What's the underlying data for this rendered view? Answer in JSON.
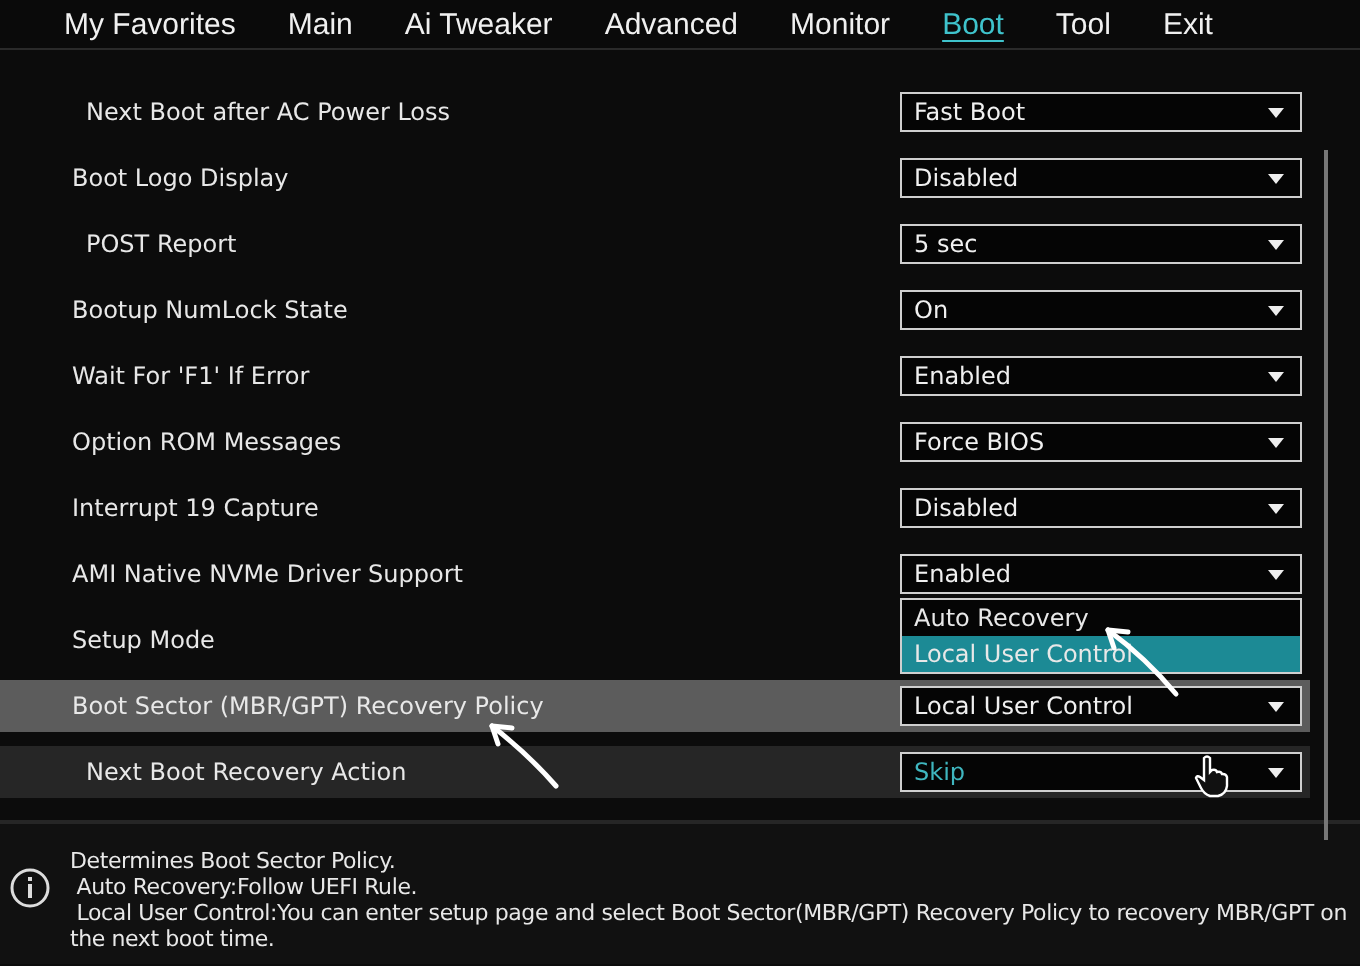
{
  "tabs": [
    {
      "label": "My Favorites",
      "selected": false
    },
    {
      "label": "Main",
      "selected": false
    },
    {
      "label": "Ai Tweaker",
      "selected": false
    },
    {
      "label": "Advanced",
      "selected": false
    },
    {
      "label": "Monitor",
      "selected": false
    },
    {
      "label": "Boot",
      "selected": true
    },
    {
      "label": "Tool",
      "selected": false
    },
    {
      "label": "Exit",
      "selected": false
    }
  ],
  "settings": [
    {
      "kind": "sub",
      "label": "Next Boot after AC Power Loss",
      "value": "Fast Boot",
      "selected": false,
      "focused": false
    },
    {
      "kind": "main",
      "label": "Boot Logo Display",
      "value": "Disabled",
      "selected": false,
      "focused": false
    },
    {
      "kind": "sub",
      "label": "POST Report",
      "value": "5 sec",
      "selected": false,
      "focused": false
    },
    {
      "kind": "main",
      "label": "Bootup NumLock State",
      "value": "On",
      "selected": false,
      "focused": false
    },
    {
      "kind": "main",
      "label": "Wait For 'F1' If Error",
      "value": "Enabled",
      "selected": false,
      "focused": false
    },
    {
      "kind": "main",
      "label": "Option ROM Messages",
      "value": "Force BIOS",
      "selected": false,
      "focused": false
    },
    {
      "kind": "main",
      "label": "Interrupt 19 Capture",
      "value": "Disabled",
      "selected": false,
      "focused": false
    },
    {
      "kind": "main",
      "label": "AMI Native NVMe Driver Support",
      "value": "Enabled",
      "selected": false,
      "focused": false
    },
    {
      "kind": "main",
      "label": "Setup Mode",
      "selected": false,
      "focused": false,
      "options": [
        {
          "label": "Auto Recovery",
          "selected": false
        },
        {
          "label": "Local User Control",
          "selected": true
        }
      ]
    },
    {
      "kind": "main",
      "label": "Boot Sector (MBR/GPT) Recovery Policy",
      "value": "Local User Control",
      "selected": true,
      "focused": false
    },
    {
      "kind": "sub",
      "label": "Next Boot Recovery Action",
      "value": "Skip",
      "selected": false,
      "focused": true
    }
  ],
  "help": {
    "lines": [
      "Determines Boot Sector Policy.",
      " Auto Recovery:Follow UEFI Rule.",
      " Local User Control:You can enter setup page and select Boot Sector(MBR/GPT) Recovery Policy to recovery MBR/GPT on the next boot time."
    ]
  }
}
